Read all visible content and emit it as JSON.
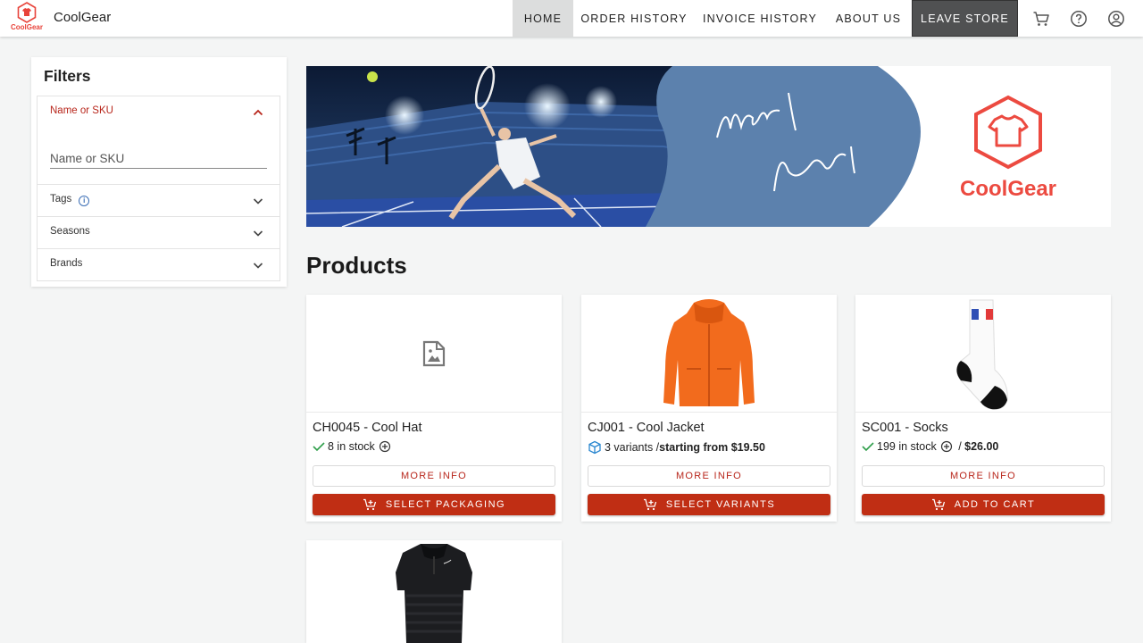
{
  "app": {
    "name": "CoolGear",
    "logo_text": "CoolGear"
  },
  "nav": {
    "items": [
      {
        "label": "HOME",
        "active": true
      },
      {
        "label": "ORDER HISTORY",
        "active": false
      },
      {
        "label": "INVOICE HISTORY",
        "active": false
      },
      {
        "label": "ABOUT US",
        "active": false
      }
    ],
    "leave_label": "LEAVE STORE",
    "icons": [
      "cart-icon",
      "help-icon",
      "account-icon"
    ]
  },
  "filters": {
    "title": "Filters",
    "sections": [
      {
        "label": "Name or SKU",
        "expanded": true
      },
      {
        "label": "Tags",
        "expanded": false,
        "has_info": true
      },
      {
        "label": "Seasons",
        "expanded": false
      },
      {
        "label": "Brands",
        "expanded": false
      }
    ],
    "search_placeholder": "Name or SKU"
  },
  "banner": {
    "line1": "Match",
    "line2": "Point",
    "brand": "CoolGear"
  },
  "products": {
    "title": "Products",
    "items": [
      {
        "title": "CH0045 - Cool Hat",
        "stock": "8 in stock",
        "more": "MORE INFO",
        "action": "SELECT PACKAGING",
        "image": "placeholder-image-icon"
      },
      {
        "title": "CJ001 - Cool Jacket",
        "variants": "3 variants / ",
        "price_text": "starting from $19.50",
        "more": "MORE INFO",
        "action": "SELECT VARIANTS",
        "image": "jacket"
      },
      {
        "title": "SC001 - Socks",
        "stock": "199 in stock",
        "price_sep": " / ",
        "price": "$26.00",
        "more": "MORE INFO",
        "action": "ADD TO CART",
        "image": "sock"
      },
      {
        "title": "",
        "image": "polo-shirt"
      }
    ]
  },
  "colors": {
    "accent": "#c02e14",
    "brand": "#ec4a40",
    "banner_blue": "#5c81ad",
    "stock_green": "#2e9e4a"
  }
}
